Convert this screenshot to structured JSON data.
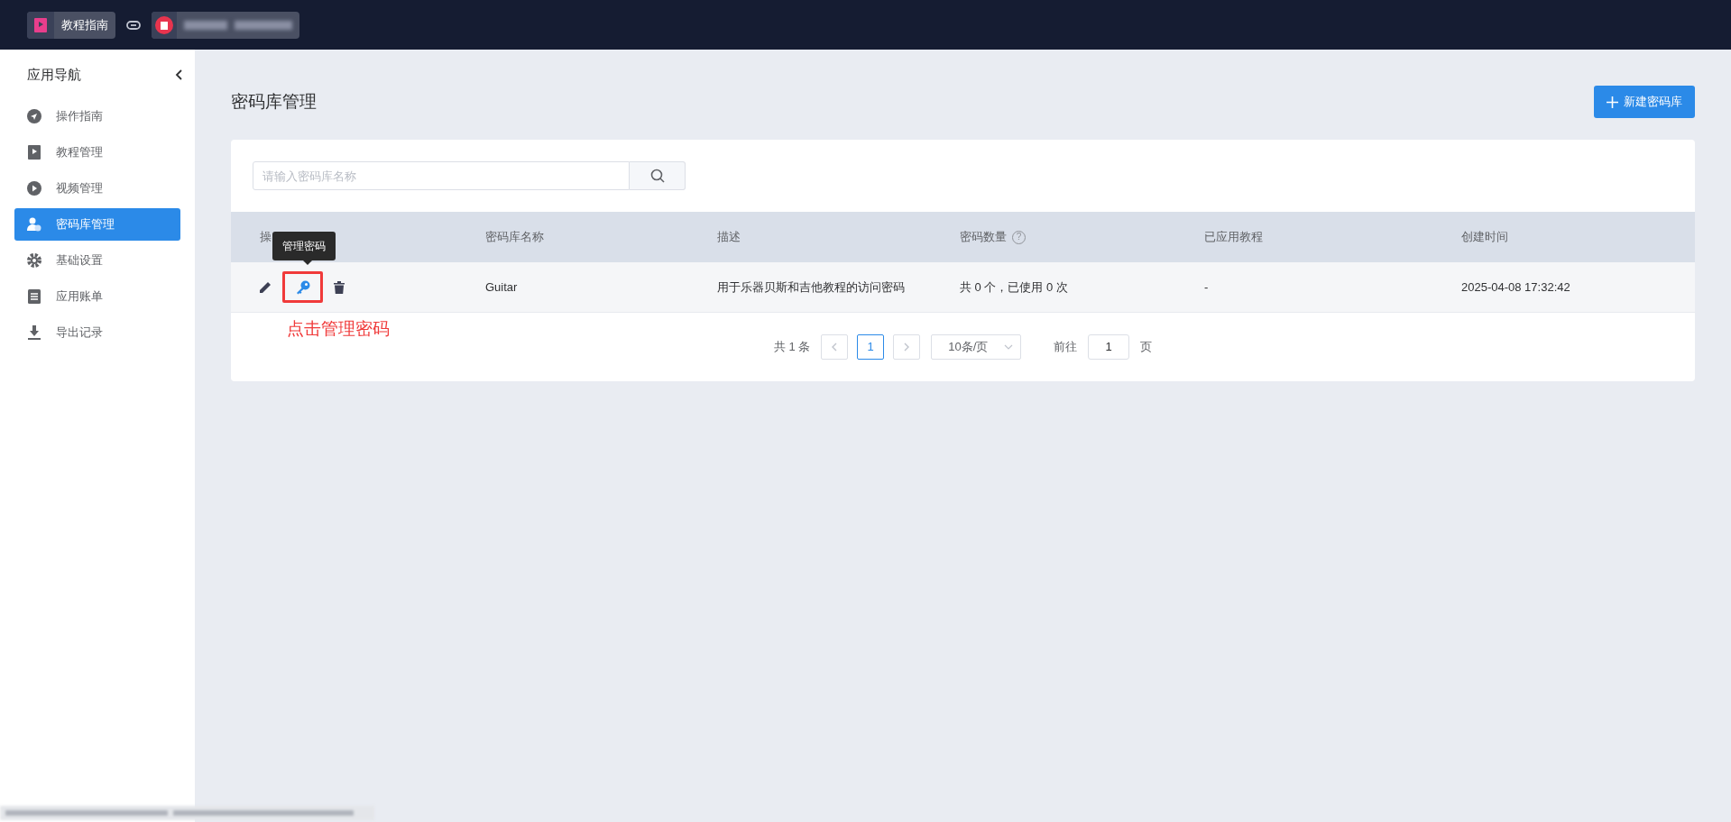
{
  "top_bar": {
    "app_tab": {
      "label": "教程指南"
    }
  },
  "sidebar": {
    "title": "应用导航",
    "items": [
      {
        "label": "操作指南",
        "selected": false
      },
      {
        "label": "教程管理",
        "selected": false
      },
      {
        "label": "视频管理",
        "selected": false
      },
      {
        "label": "密码库管理",
        "selected": true
      },
      {
        "label": "基础设置",
        "selected": false
      },
      {
        "label": "应用账单",
        "selected": false
      },
      {
        "label": "导出记录",
        "selected": false
      }
    ]
  },
  "page": {
    "title": "密码库管理",
    "new_button": "新建密码库"
  },
  "search": {
    "placeholder": "请输入密码库名称"
  },
  "table": {
    "columns": [
      "操",
      "密码库名称",
      "描述",
      "密码数量",
      "已应用教程",
      "创建时间"
    ],
    "count_help": "?",
    "rows": [
      {
        "name": "Guitar",
        "description": "用于乐器贝斯和吉他教程的访问密码",
        "count": "共 0 个，已使用 0 次",
        "applied": "-",
        "created": "2025-04-08 17:32:42"
      }
    ]
  },
  "tooltip": "管理密码",
  "annotation": "点击管理密码",
  "pagination": {
    "total": "共 1 条",
    "pages": [
      {
        "label": "1",
        "selected": true
      }
    ],
    "page_size": "10条/页",
    "goto_label": "前往",
    "goto_value": "1",
    "goto_suffix": "页"
  }
}
